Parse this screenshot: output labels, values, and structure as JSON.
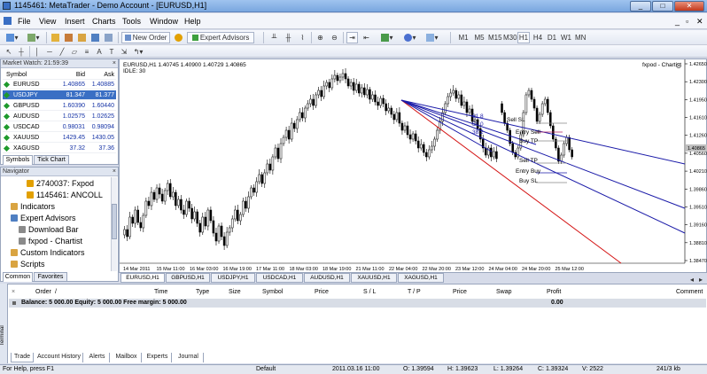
{
  "window": {
    "title": "1145461: MetaTrader - Demo Account - [EURUSD,H1]",
    "min": "_",
    "max": "□",
    "close": "✕"
  },
  "menu": [
    "File",
    "View",
    "Insert",
    "Charts",
    "Tools",
    "Window",
    "Help"
  ],
  "menu_right": [
    "_",
    "▫",
    "✕"
  ],
  "toolbar": {
    "new_order": "New Order",
    "expert_advisors": "Expert Advisors",
    "timeframes": [
      "M1",
      "M5",
      "M15",
      "M30",
      "H1",
      "H4",
      "D1",
      "W1",
      "MN"
    ],
    "active_timeframe": "H1"
  },
  "market_watch": {
    "title": "Market Watch: 21:59:39",
    "headers": {
      "symbol": "Symbol",
      "bid": "Bid",
      "ask": "Ask"
    },
    "rows": [
      {
        "symbol": "EURUSD",
        "bid": "1.40865",
        "ask": "1.40885"
      },
      {
        "symbol": "USDJPY",
        "bid": "81.347",
        "ask": "81.377"
      },
      {
        "symbol": "GBPUSD",
        "bid": "1.60390",
        "ask": "1.60440"
      },
      {
        "symbol": "AUDUSD",
        "bid": "1.02575",
        "ask": "1.02625"
      },
      {
        "symbol": "USDCAD",
        "bid": "0.98031",
        "ask": "0.98094"
      },
      {
        "symbol": "XAUUSD",
        "bid": "1429.45",
        "ask": "1430.05"
      },
      {
        "symbol": "XAGUSD",
        "bid": "37.32",
        "ask": "37.36"
      }
    ],
    "selected_index": 1,
    "tabs": [
      "Symbols",
      "Tick Chart"
    ]
  },
  "navigator": {
    "title": "Navigator",
    "items": [
      {
        "label": "2740037: Fxpod",
        "indent": 3
      },
      {
        "label": "1145461: ANCOLL",
        "indent": 3
      },
      {
        "label": "Indicators",
        "indent": 1
      },
      {
        "label": "Expert Advisors",
        "indent": 1
      },
      {
        "label": "Download Bar",
        "indent": 2
      },
      {
        "label": "fxpod - Chartist",
        "indent": 2
      },
      {
        "label": "Custom Indicators",
        "indent": 1
      },
      {
        "label": "Scripts",
        "indent": 1
      }
    ],
    "tabs": [
      "Common",
      "Favorites"
    ]
  },
  "chart": {
    "info_line1": "EURUSD,H1  1.40745 1.40900 1.40729 1.40865",
    "info_line2": "IDLE: 30",
    "ea_label": "fxpod - Chartist",
    "current_price": "1.40865",
    "price_labels": [
      "1.42650",
      "1.42300",
      "1.41950",
      "1.41610",
      "1.41260",
      "1.40560",
      "1.40210",
      "1.39860",
      "1.39510",
      "1.39160",
      "1.38810",
      "1.38470"
    ],
    "time_labels": [
      "14 Mar 2011",
      "15 Mar 11:00",
      "16 Mar 03:00",
      "16 Mar 19:00",
      "17 Mar 11:00",
      "18 Mar 03:00",
      "18 Mar 19:00",
      "21 Mar 11:00",
      "22 Mar 04:00",
      "22 Mar 20:00",
      "23 Mar 12:00",
      "24 Mar 04:00",
      "24 Mar 20:00",
      "25 Mar 12:00"
    ],
    "annotations": {
      "sell_sl": "Sell SL",
      "entry_sell": "Entry Sell",
      "buy_tp": "Buy TP",
      "sell_tp": "Sell TP",
      "entry_buy": "Entry Buy",
      "buy_sl": "Buy SL",
      "fib_618": "61.8",
      "fib_50": "50.0",
      "fib_382": "38.2"
    },
    "colors": {
      "bull": "#000000",
      "bear": "#000000",
      "trend_blue": "#1a1aa8",
      "trend_red": "#d41414",
      "price_tag": "#c0c0c0"
    }
  },
  "chart_tabs": [
    "EURUSD,H1",
    "GBPUSD,H1",
    "USDJPY,H1",
    "USDCAD,H1",
    "AUDUSD,H1",
    "XAUUSD,H1",
    "XAGUSD,H1"
  ],
  "terminal": {
    "headers": [
      "Order",
      "/",
      "Time",
      "Type",
      "Size",
      "Symbol",
      "Price",
      "S / L",
      "T / P",
      "Price",
      "Swap",
      "Profit",
      "Comment"
    ],
    "balance_line": "Balance: 5 000.00  Equity: 5 000.00  Free margin: 5 000.00",
    "profit_total": "0.00",
    "side_label": "Terminal",
    "tabs": [
      "Trade",
      "Account History",
      "Alerts",
      "Mailbox",
      "Experts",
      "Journal"
    ]
  },
  "status": {
    "help": "For Help, press F1",
    "profile": "Default",
    "datetime": "2011.03.16 11:00",
    "open": "O: 1.39594",
    "high": "H: 1.39623",
    "low": "L: 1.39264",
    "close": "C: 1.39324",
    "volume": "V: 2522",
    "traffic": "241/3 kb"
  }
}
